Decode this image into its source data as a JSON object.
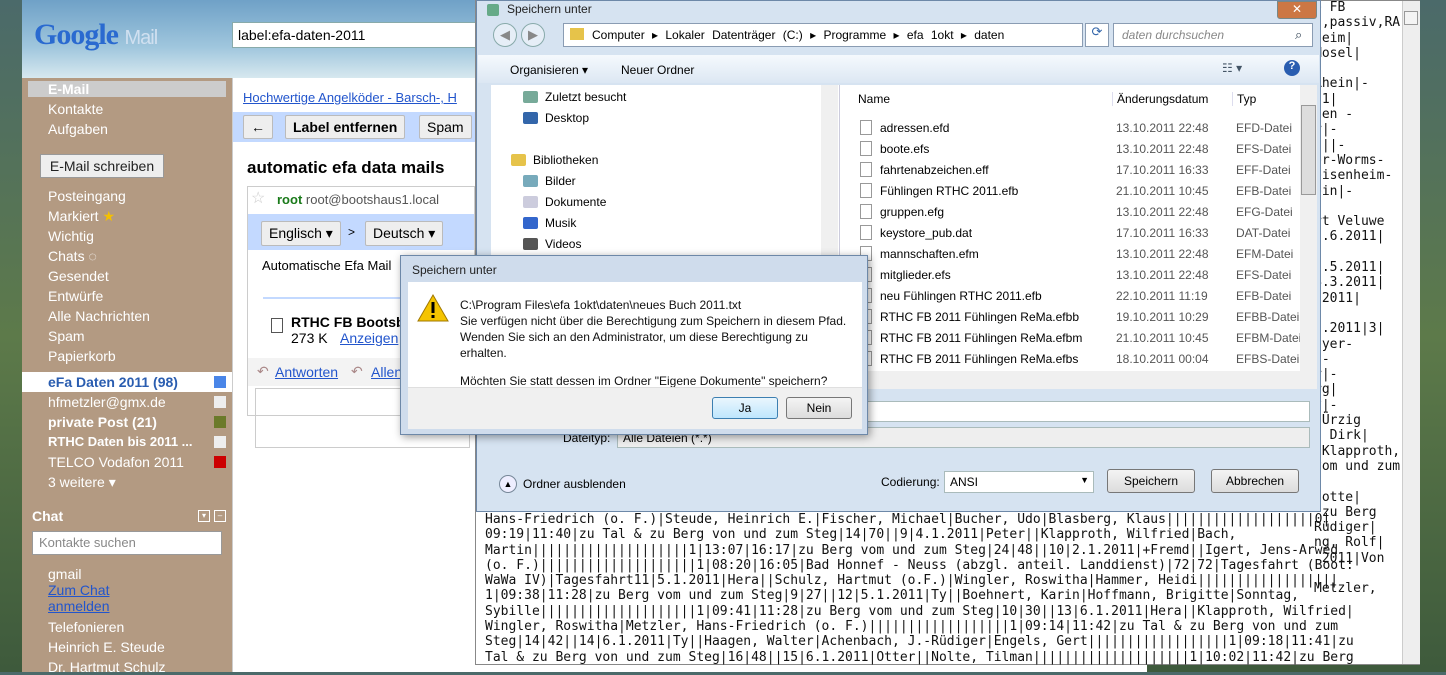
{
  "gmail": {
    "logo": "Google",
    "logo_sub": "Mail",
    "search_value": "label:efa-daten-2011",
    "nav": [
      "E-Mail",
      "Kontakte",
      "Aufgaben"
    ],
    "compose": "E-Mail schreiben",
    "folders": [
      "Posteingang",
      "Markiert",
      "Wichtig",
      "Chats",
      "Gesendet",
      "Entwürfe",
      "Alle Nachrichten",
      "Spam",
      "Papierkorb"
    ],
    "labels": [
      {
        "name": "eFa Daten 2011 (98)",
        "color": "#4a86e8",
        "bold": true,
        "selected": true
      },
      {
        "name": "hfmetzler@gmx.de",
        "color": "#eeeeee",
        "bold": false
      },
      {
        "name": "private Post (21)",
        "color": "#6b7a2a",
        "bold": true
      },
      {
        "name": "RTHC Daten bis 2011 ...",
        "color": "#eeeeee",
        "bold": true
      },
      {
        "name": "TELCO Vodafon 2011",
        "color": "#cc0000",
        "bold": false
      }
    ],
    "more": "3 weitere ▾",
    "chat": {
      "title": "Chat",
      "search_placeholder": "Kontakte suchen",
      "me": "gmail",
      "links": [
        "Zum Chat",
        "anmelden"
      ],
      "contacts": [
        "Telefonieren",
        "Heinrich E. Steude",
        "Dr. Hartmut Schulz"
      ]
    },
    "ad": "Hochwertige Angelköder - Barsch-, H",
    "toolbar": {
      "back": "←",
      "remove_label": "Label entfernen",
      "spam": "Spam"
    },
    "subject": "automatic efa data mails",
    "sender_name": "root",
    "sender_email": "root@bootshaus1.local",
    "translate": {
      "from": "Englisch ▾",
      "sep": ">",
      "to": "Deutsch ▾"
    },
    "body": "Automatische Efa Mail",
    "attachment": {
      "name": "RTHC FB Bootsb",
      "size": "273 K",
      "view": "Anzeigen"
    },
    "reply": "Antworten",
    "reply_all": "Allen"
  },
  "editor": {
    "right_lines": [
      "e FB",
      "),passiv,RA",
      "heim|",
      "Mosel|",
      "",
      "Rhein|-",
      "11|",
      "den -",
      "r|-",
      "6||-",
      "er-Worms-",
      "eisenheim-",
      "ein|-",
      "",
      "rt Veluwe",
      "5.6.2011|",
      "",
      "0.5.2011|",
      "4.3.2011|",
      " 2011|",
      "",
      "9.2011|3|",
      "eyer-",
      " -",
      "r|-",
      "rg|",
      "v|-",
      " Ürzig",
      "  Dirk|",
      " Klapproth,",
      "vom und zum",
      "",
      " otte|",
      " zu Berg",
      "Rüdiger|",
      "ng, Rolf|",
      " 2011|Von",
      "",
      "Metzler,"
    ],
    "bottom_lines": [
      "Hans-Friedrich (o. F.)|Steude, Heinrich E.|Fischer, Michael|Bucher, Udo|Blasberg, Klaus|||||||||||||||||||0|",
      "09:19|11:40|zu Tal & zu Berg von und zum Steg|14|70||9|4.1.2011|Peter||Klapproth, Wilfried|Bach,",
      "Martin||||||||||||||||||||1|13:07|16:17|zu Berg vom und zum Steg|24|48||10|2.1.2011|+Fremd||Igert, Jens-Arwed",
      "(o. F.)||||||||||||||||||||1|08:20|16:05|Bad Honnef - Neuss (abzgl. anteil. Landdienst)|72|72|Tagesfahrt (Boot:",
      "WaWa IV)|Tagesfahrt11|5.1.2011|Hera||Schulz, Hartmut (o.F.)|Wingler, Roswitha|Hammer, Heidi||||||||||||||||||",
      "1|09:38|11:28|zu Berg vom und zum Steg|9|27||12|5.1.2011|Ty||Boehnert, Karin|Hoffmann, Brigitte|Sonntag,",
      "Sybille||||||||||||||||||||1|09:41|11:28|zu Berg vom und zum Steg|10|30||13|6.1.2011|Hera||Klapproth, Wilfried|",
      "Wingler, Roswitha|Metzler, Hans-Friedrich (o. F.)||||||||||||||||||1|09:14|11:42|zu Tal & zu Berg von und zum",
      "Steg|14|42||14|6.1.2011|Ty||Haagen, Walter|Achenbach, J.-Rüdiger|Engels, Gert||||||||||||||||||1|09:18|11:41|zu",
      "Tal & zu Berg von und zum Steg|16|48||15|6.1.2011|Otter||Nolte, Tilman||||||||||||||||||||1|10:02|11:42|zu Berg"
    ]
  },
  "save_dialog": {
    "title": "Speichern unter",
    "breadcrumb": "Computer ▸ Lokaler Datenträger (C:) ▸ Programme ▸ efa 1okt ▸ daten",
    "search_placeholder": "daten durchsuchen",
    "organize": "Organisieren ▾",
    "new_folder": "Neuer Ordner",
    "nav": [
      {
        "label": "Zuletzt besucht",
        "icon": "recent-icon"
      },
      {
        "label": "Desktop",
        "icon": "desktop-icon"
      },
      {
        "label": "Bibliotheken",
        "icon": "library-icon"
      },
      {
        "label": "Bilder",
        "icon": "pictures-icon"
      },
      {
        "label": "Dokumente",
        "icon": "documents-icon"
      },
      {
        "label": "Musik",
        "icon": "music-icon"
      },
      {
        "label": "Videos",
        "icon": "videos-icon"
      }
    ],
    "columns": [
      "Name",
      "Änderungsdatum",
      "Typ"
    ],
    "files": [
      [
        "adressen.efd",
        "13.10.2011 22:48",
        "EFD-Datei"
      ],
      [
        "boote.efs",
        "13.10.2011 22:48",
        "EFS-Datei"
      ],
      [
        "fahrtenabzeichen.eff",
        "17.10.2011 16:33",
        "EFF-Datei"
      ],
      [
        "Fühlingen RTHC 2011.efb",
        "21.10.2011 10:45",
        "EFB-Datei"
      ],
      [
        "gruppen.efg",
        "13.10.2011 22:48",
        "EFG-Datei"
      ],
      [
        "keystore_pub.dat",
        "17.10.2011 16:33",
        "DAT-Datei"
      ],
      [
        "mannschaften.efm",
        "13.10.2011 22:48",
        "EFM-Datei"
      ],
      [
        "mitglieder.efs",
        "13.10.2011 22:48",
        "EFS-Datei"
      ],
      [
        "neu  Fühlingen RTHC 2011.efb",
        "22.10.2011 11:19",
        "EFB-Datei"
      ],
      [
        "RTHC FB 2011 Fühlingen ReMa.efbb",
        "19.10.2011 10:29",
        "EFBB-Datei"
      ],
      [
        "RTHC FB 2011 Fühlingen ReMa.efbm",
        "21.10.2011 10:45",
        "EFBM-Datei"
      ],
      [
        "RTHC FB 2011 Fühlingen ReMa.efbs",
        "18.10.2011 00:04",
        "EFBS-Datei"
      ]
    ],
    "filetype_label": "Dateityp:",
    "filetype_value": "Alle Dateien (*.*)",
    "hide_folders": "Ordner ausblenden",
    "encoding_label": "Codierung:",
    "encoding_value": "ANSI",
    "save": "Speichern",
    "cancel": "Abbrechen"
  },
  "alert": {
    "title": "Speichern unter",
    "lines": [
      "C:\\Program Files\\efa 1okt\\daten\\neues Buch 2011.txt",
      "Sie verfügen nicht über die Berechtigung zum Speichern in diesem Pfad.",
      "Wenden Sie sich an den Administrator, um diese Berechtigung zu erhalten."
    ],
    "question": "Möchten Sie statt dessen im Ordner \"Eigene Dokumente\" speichern?",
    "yes": "Ja",
    "no": "Nein"
  }
}
